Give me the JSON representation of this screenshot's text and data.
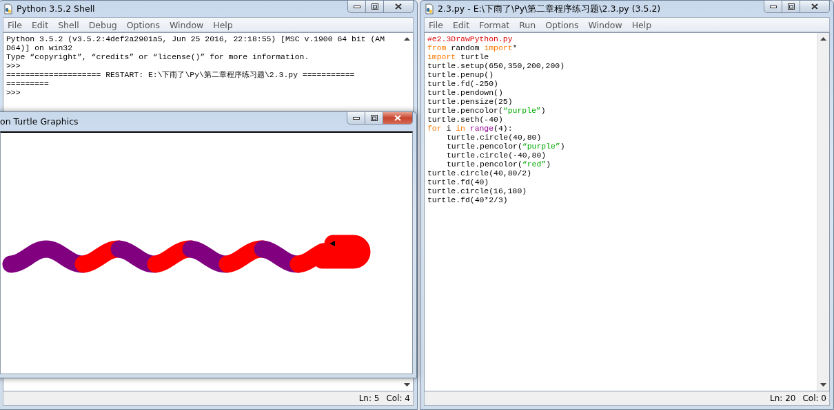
{
  "shell_window": {
    "title": "Python 3.5.2 Shell",
    "menu": [
      "File",
      "Edit",
      "Shell",
      "Debug",
      "Options",
      "Window",
      "Help"
    ],
    "output": [
      "Python 3.5.2 (v3.5.2:4def2a2901a5, Jun 25 2016, 22:18:55) [MSC v.1900 64 bit (AM",
      "D64)] on win32",
      "Type “copyright”, “credits” or “license()” for more information.",
      ">>>",
      "==================== RESTART: E:\\下雨了\\Py\\第二章程序练习题\\2.3.py ===========",
      "=========",
      ">>>"
    ],
    "status_bar": {
      "line": "Ln: 5",
      "column": "Col: 4"
    }
  },
  "editor_window": {
    "title": "2.3.py - E:\\下雨了\\Py\\第二章程序练习题\\2.3.py (3.5.2)",
    "menu": [
      "File",
      "Edit",
      "Format",
      "Run",
      "Options",
      "Window",
      "Help"
    ],
    "code": [
      {
        "indented": false,
        "tokens": [
          {
            "kind": "comment",
            "text": "#e2.3DrawPython.py"
          }
        ]
      },
      {
        "indented": false,
        "tokens": [
          {
            "kind": "keyword",
            "text": "from"
          },
          {
            "kind": "plain",
            "text": " random "
          },
          {
            "kind": "keyword",
            "text": "import"
          },
          {
            "kind": "plain",
            "text": "*"
          }
        ]
      },
      {
        "indented": false,
        "tokens": [
          {
            "kind": "keyword",
            "text": "import"
          },
          {
            "kind": "plain",
            "text": " turtle"
          }
        ]
      },
      {
        "indented": false,
        "tokens": [
          {
            "kind": "plain",
            "text": "turtle.setup(650,350,200,200)"
          }
        ]
      },
      {
        "indented": false,
        "tokens": [
          {
            "kind": "plain",
            "text": "turtle.penup()"
          }
        ]
      },
      {
        "indented": false,
        "tokens": [
          {
            "kind": "plain",
            "text": "turtle.fd(-250)"
          }
        ]
      },
      {
        "indented": false,
        "tokens": [
          {
            "kind": "plain",
            "text": "turtle.pendown()"
          }
        ]
      },
      {
        "indented": false,
        "tokens": [
          {
            "kind": "plain",
            "text": "turtle.pensize(25)"
          }
        ]
      },
      {
        "indented": false,
        "tokens": [
          {
            "kind": "plain",
            "text": "turtle.pencolor("
          },
          {
            "kind": "string",
            "text": "“purple”"
          },
          {
            "kind": "plain",
            "text": ")"
          }
        ]
      },
      {
        "indented": false,
        "tokens": [
          {
            "kind": "plain",
            "text": "turtle.seth(-40)"
          }
        ]
      },
      {
        "indented": false,
        "tokens": [
          {
            "kind": "keyword",
            "text": "for"
          },
          {
            "kind": "plain",
            "text": " i "
          },
          {
            "kind": "keyword",
            "text": "in "
          },
          {
            "kind": "builtin",
            "text": "range"
          },
          {
            "kind": "plain",
            "text": "(4):"
          }
        ]
      },
      {
        "indented": true,
        "tokens": [
          {
            "kind": "plain",
            "text": "turtle.circle(40,80)"
          }
        ]
      },
      {
        "indented": true,
        "tokens": [
          {
            "kind": "plain",
            "text": "turtle.pencolor("
          },
          {
            "kind": "string",
            "text": "“purple”"
          },
          {
            "kind": "plain",
            "text": ")"
          }
        ]
      },
      {
        "indented": true,
        "tokens": [
          {
            "kind": "plain",
            "text": "turtle.circle(-40,80)"
          }
        ]
      },
      {
        "indented": true,
        "tokens": [
          {
            "kind": "plain",
            "text": "turtle.pencolor("
          },
          {
            "kind": "string",
            "text": "“red”"
          },
          {
            "kind": "plain",
            "text": ")"
          }
        ]
      },
      {
        "indented": false,
        "tokens": [
          {
            "kind": "plain",
            "text": "turtle.circle(40,80/2)"
          }
        ]
      },
      {
        "indented": false,
        "tokens": [
          {
            "kind": "plain",
            "text": "turtle.fd(40)"
          }
        ]
      },
      {
        "indented": false,
        "tokens": [
          {
            "kind": "plain",
            "text": "turtle.circle(16,180)"
          }
        ]
      },
      {
        "indented": false,
        "tokens": [
          {
            "kind": "plain",
            "text": "turtle.fd(40*2/3)"
          }
        ]
      }
    ],
    "status_bar": {
      "line": "Ln: 20",
      "column": "Col: 0"
    }
  },
  "turtle_window": {
    "title": "on Turtle Graphics"
  }
}
